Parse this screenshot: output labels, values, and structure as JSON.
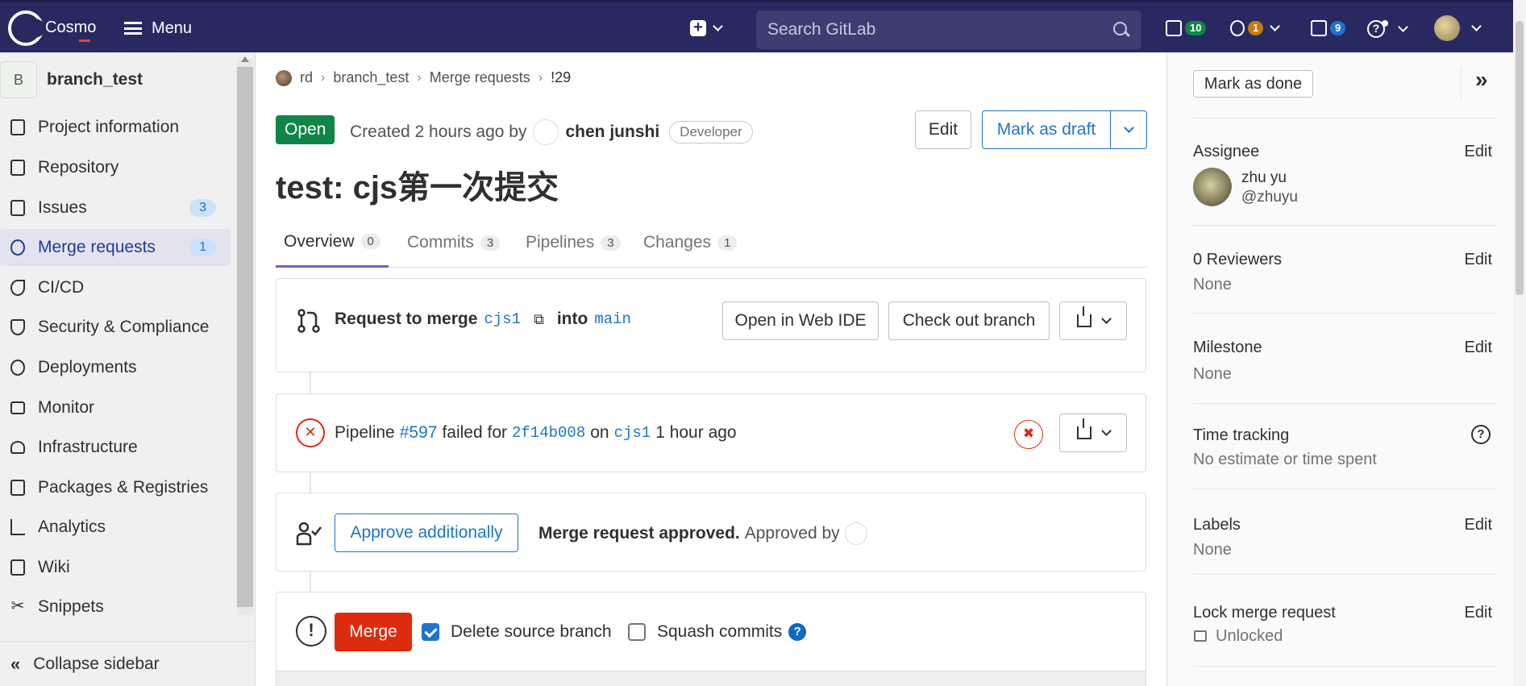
{
  "topbar": {
    "brand": "Cosmo",
    "menu_label": "Menu",
    "search_placeholder": "Search GitLab",
    "issues_count": "10",
    "mr_count": "1",
    "todo_count": "9"
  },
  "sidebar": {
    "project_initial": "B",
    "project_name": "branch_test",
    "items": [
      {
        "label": "Project information",
        "icon": "info-doc-icon"
      },
      {
        "label": "Repository",
        "icon": "repository-icon"
      },
      {
        "label": "Issues",
        "icon": "issues-icon",
        "badge": "3"
      },
      {
        "label": "Merge requests",
        "icon": "merge-request-icon",
        "badge": "1"
      },
      {
        "label": "CI/CD",
        "icon": "rocket-icon"
      },
      {
        "label": "Security & Compliance",
        "icon": "shield-icon"
      },
      {
        "label": "Deployments",
        "icon": "deployments-icon"
      },
      {
        "label": "Monitor",
        "icon": "monitor-icon"
      },
      {
        "label": "Infrastructure",
        "icon": "cloud-icon"
      },
      {
        "label": "Packages & Registries",
        "icon": "package-icon"
      },
      {
        "label": "Analytics",
        "icon": "chart-icon"
      },
      {
        "label": "Wiki",
        "icon": "book-icon"
      },
      {
        "label": "Snippets",
        "icon": "scissors-icon"
      }
    ],
    "collapse_label": "Collapse sidebar"
  },
  "breadcrumb": [
    "rd",
    "branch_test",
    "Merge requests",
    "!29"
  ],
  "mr": {
    "status": "Open",
    "created_text": "Created 2 hours ago by",
    "author": "chen junshi",
    "role": "Developer",
    "edit_label": "Edit",
    "draft_label": "Mark as draft",
    "title": "test: cjs第一次提交"
  },
  "tabs": [
    {
      "label": "Overview",
      "count": "0"
    },
    {
      "label": "Commits",
      "count": "3"
    },
    {
      "label": "Pipelines",
      "count": "3"
    },
    {
      "label": "Changes",
      "count": "1"
    }
  ],
  "request": {
    "prefix": "Request to merge",
    "source": "cjs1",
    "into": "into",
    "target": "main",
    "web_ide": "Open in Web IDE",
    "checkout": "Check out branch"
  },
  "pipeline": {
    "prefix": "Pipeline",
    "id": "#597",
    "failed_for": "failed for",
    "sha": "2f14b008",
    "on": "on",
    "branch": "cjs1",
    "time": "1 hour ago"
  },
  "approval": {
    "button": "Approve additionally",
    "status": "Merge request approved.",
    "approved_by": "Approved by"
  },
  "merge": {
    "button": "Merge",
    "delete_source": "Delete source branch",
    "delete_checked": true,
    "squash": "Squash commits",
    "squash_checked": false
  },
  "right_sidebar": {
    "mark_done": "Mark as done",
    "assignee_label": "Assignee",
    "assignee_name": "zhu yu",
    "assignee_handle": "@zhuyu",
    "reviewers_label": "0 Reviewers",
    "reviewers_value": "None",
    "milestone_label": "Milestone",
    "milestone_value": "None",
    "time_label": "Time tracking",
    "time_value": "No estimate or time spent",
    "labels_label": "Labels",
    "labels_value": "None",
    "lock_label": "Lock merge request",
    "lock_value": "Unlocked",
    "edit": "Edit"
  },
  "colors": {
    "topbar": "#292961",
    "open_badge": "#108548",
    "link": "#1f75cb",
    "danger": "#dd2b0e"
  }
}
